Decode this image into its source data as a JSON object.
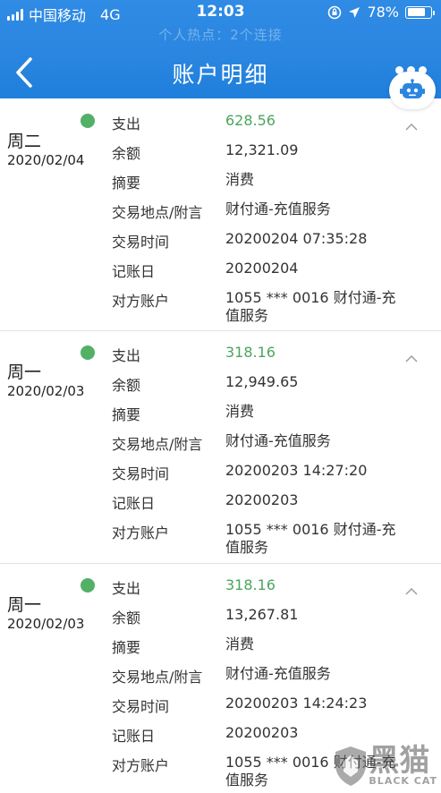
{
  "status_bar": {
    "carrier": "中国移动",
    "network": "4G",
    "time": "12:03",
    "battery": "78%",
    "battery_level": 0.78
  },
  "header": {
    "subtitle": "个人热点：2个连接",
    "title": "账户明细"
  },
  "colors": {
    "header_blue": "#2a86e0",
    "amount_green": "#4aa55c",
    "dot_green": "#52b067"
  },
  "records": [
    {
      "day": "周二",
      "date": "2020/02/04",
      "rows": [
        {
          "label": "支出",
          "value": "628.56"
        },
        {
          "label": "余额",
          "value": "12,321.09"
        },
        {
          "label": "摘要",
          "value": "消费"
        },
        {
          "label": "交易地点/附言",
          "value": "财付通-充值服务"
        },
        {
          "label": "交易时间",
          "value": "20200204 07:35:28"
        },
        {
          "label": "记账日",
          "value": "20200204"
        },
        {
          "label": "对方账户",
          "value": "1055 *** 0016 财付通-充值服务"
        }
      ]
    },
    {
      "day": "周一",
      "date": "2020/02/03",
      "rows": [
        {
          "label": "支出",
          "value": "318.16"
        },
        {
          "label": "余额",
          "value": "12,949.65"
        },
        {
          "label": "摘要",
          "value": "消费"
        },
        {
          "label": "交易地点/附言",
          "value": "财付通-充值服务"
        },
        {
          "label": "交易时间",
          "value": "20200203 14:27:20"
        },
        {
          "label": "记账日",
          "value": "20200203"
        },
        {
          "label": "对方账户",
          "value": "1055 *** 0016 财付通-充值服务"
        }
      ]
    },
    {
      "day": "周一",
      "date": "2020/02/03",
      "rows": [
        {
          "label": "支出",
          "value": "318.16"
        },
        {
          "label": "余额",
          "value": "13,267.81"
        },
        {
          "label": "摘要",
          "value": "消费"
        },
        {
          "label": "交易地点/附言",
          "value": "财付通-充值服务"
        },
        {
          "label": "交易时间",
          "value": "20200203 14:24:23"
        },
        {
          "label": "记账日",
          "value": "20200203"
        },
        {
          "label": "对方账户",
          "value": "1055 *** 0016 财付通-充值服务"
        }
      ]
    }
  ],
  "watermark": {
    "cn": "黑猫",
    "en": "BLACK CAT",
    "icon": "shield-logo-icon"
  }
}
